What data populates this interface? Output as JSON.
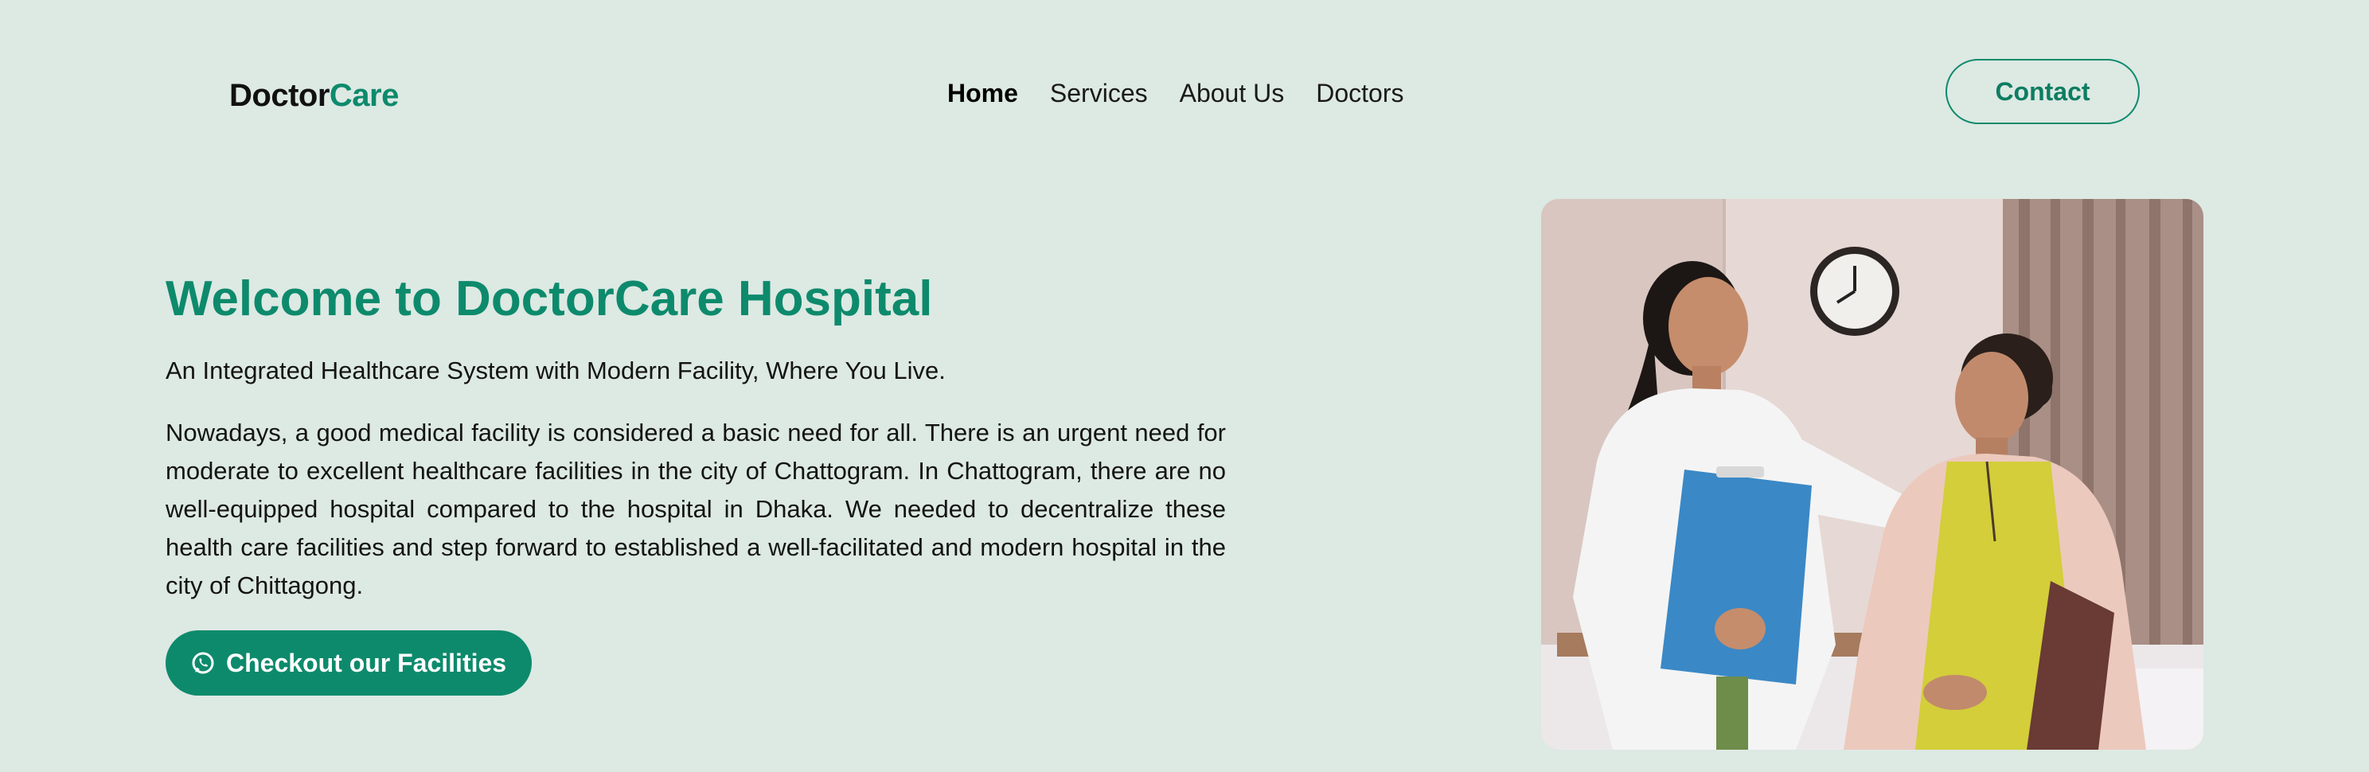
{
  "header": {
    "logo_part1": "Doctor",
    "logo_part2": "Care",
    "nav": [
      {
        "label": "Home",
        "active": true
      },
      {
        "label": "Services",
        "active": false
      },
      {
        "label": "About Us",
        "active": false
      },
      {
        "label": "Doctors",
        "active": false
      }
    ],
    "contact_label": "Contact"
  },
  "hero": {
    "title": "Welcome to DoctorCare Hospital",
    "subtitle": "An Integrated Healthcare System with Modern Facility, Where You Live.",
    "body": "Nowadays, a good medical facility is considered a basic need for all. There is an urgent need for moderate to excellent healthcare facilities in the city of Chattogram. In Chattogram, there are no well-equipped hospital compared to the hospital in Dhaka. We needed to decentralize these health care facilities and step forward to established a well-facilitated and modern hospital in the city of Chittagong.",
    "cta_label": "Checkout our Facilities",
    "cta_icon": "whatsapp-icon",
    "image": "doctor-with-patient-photo"
  },
  "colors": {
    "background": "#dde9e3",
    "accent": "#0d8a6c",
    "text": "#141414"
  }
}
